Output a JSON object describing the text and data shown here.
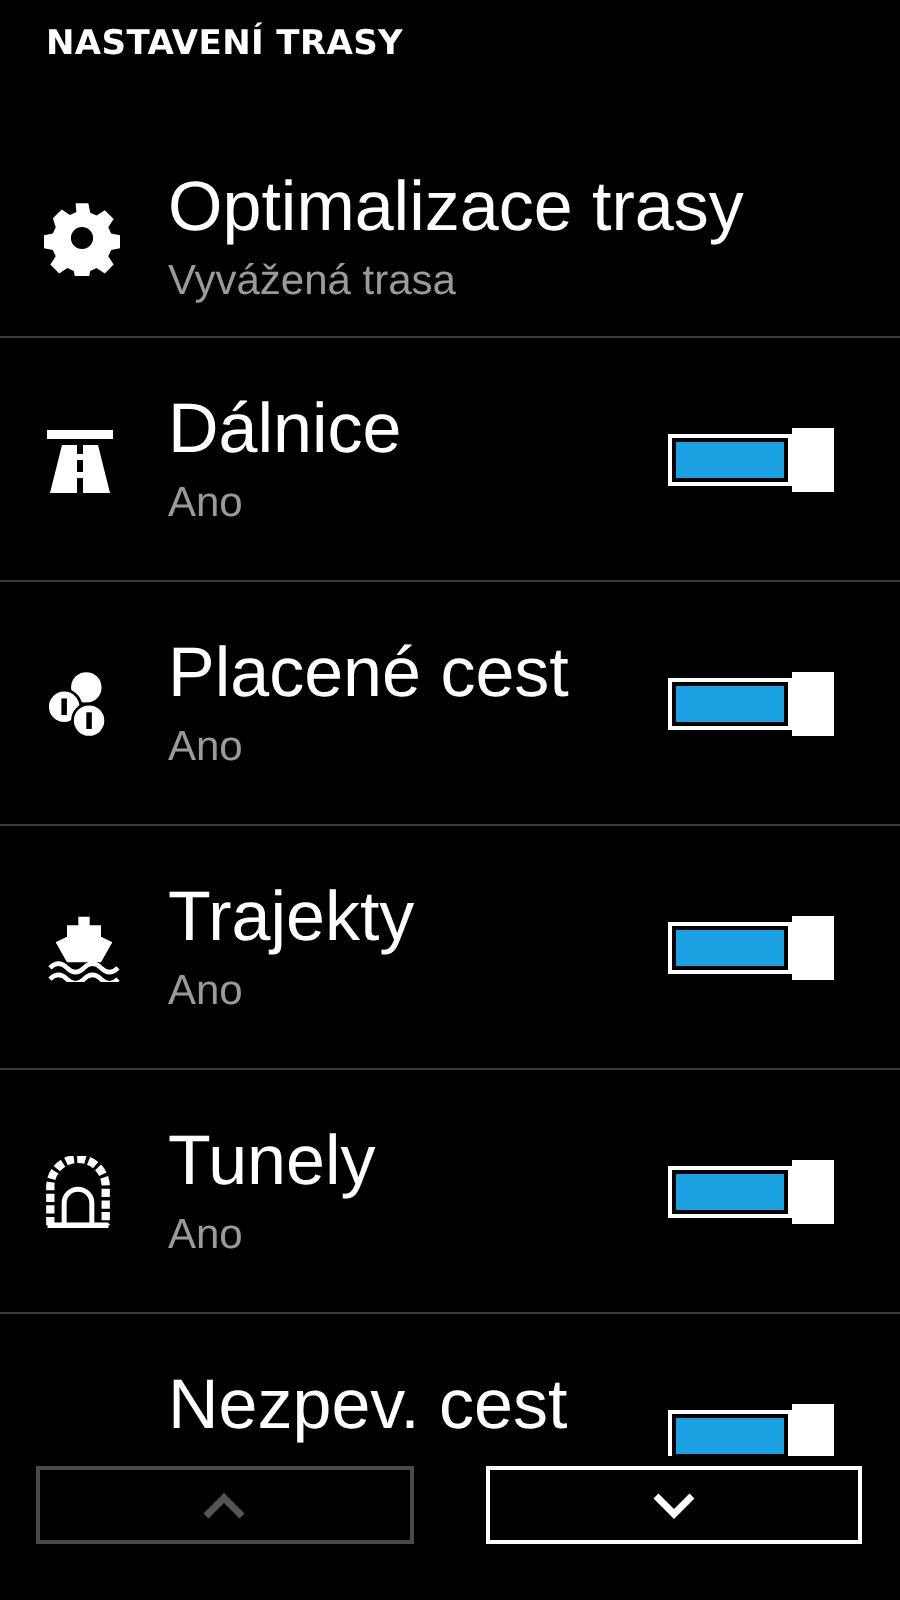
{
  "header": {
    "title": "NASTAVENÍ TRASY"
  },
  "items": [
    {
      "kind": "option",
      "title": "Optimalizace trasy",
      "subtitle": "Vyvážená trasa"
    },
    {
      "kind": "toggle",
      "title": "Dálnice",
      "subtitle": "Ano",
      "on": true
    },
    {
      "kind": "toggle",
      "title": "Placené cest",
      "subtitle": "Ano",
      "on": true
    },
    {
      "kind": "toggle",
      "title": "Trajekty",
      "subtitle": "Ano",
      "on": true
    },
    {
      "kind": "toggle",
      "title": "Tunely",
      "subtitle": "Ano",
      "on": true
    },
    {
      "kind": "toggle",
      "title": "Nezpev. cest",
      "on": true
    }
  ],
  "nav": {
    "up": {
      "disabled": true
    },
    "down": {
      "disabled": false
    }
  }
}
